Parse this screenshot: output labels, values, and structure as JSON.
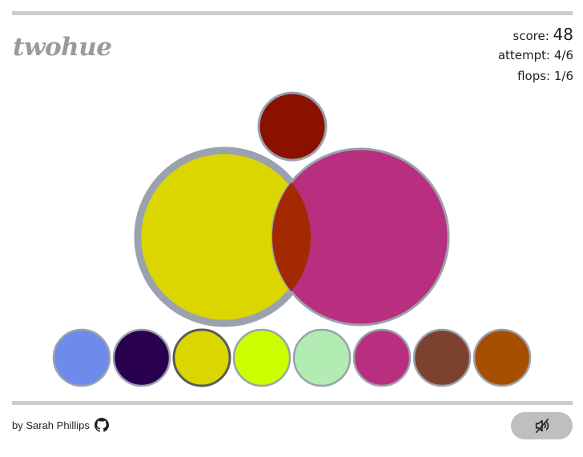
{
  "app": {
    "logo_text": "twohue"
  },
  "stats": {
    "score_label": "score:",
    "score_value": "48",
    "attempt_label": "attempt:",
    "attempt_value": "4/6",
    "flops_label": "flops:",
    "flops_value": "1/6"
  },
  "target": {
    "color": "#8a1000"
  },
  "mix": {
    "left_color": "#dcd600",
    "right_color": "#b82f80",
    "overlap_color": "#a32a00"
  },
  "palette": [
    {
      "color": "#6e8bec",
      "selected": false
    },
    {
      "color": "#28004f",
      "selected": false
    },
    {
      "color": "#dcd600",
      "selected": true
    },
    {
      "color": "#ccff00",
      "selected": false
    },
    {
      "color": "#b2ecb2",
      "selected": false
    },
    {
      "color": "#b82f80",
      "selected": false
    },
    {
      "color": "#7d412f",
      "selected": false
    },
    {
      "color": "#a84e00",
      "selected": false
    }
  ],
  "footer": {
    "credit_text": "by Sarah Phillips",
    "github_icon": "github-icon",
    "sound_icon": "sound-muted-icon"
  },
  "theme": {
    "rule_color": "#cccccc",
    "ring_color": "#9aa2ad",
    "button_bg": "#bfbfbf"
  }
}
